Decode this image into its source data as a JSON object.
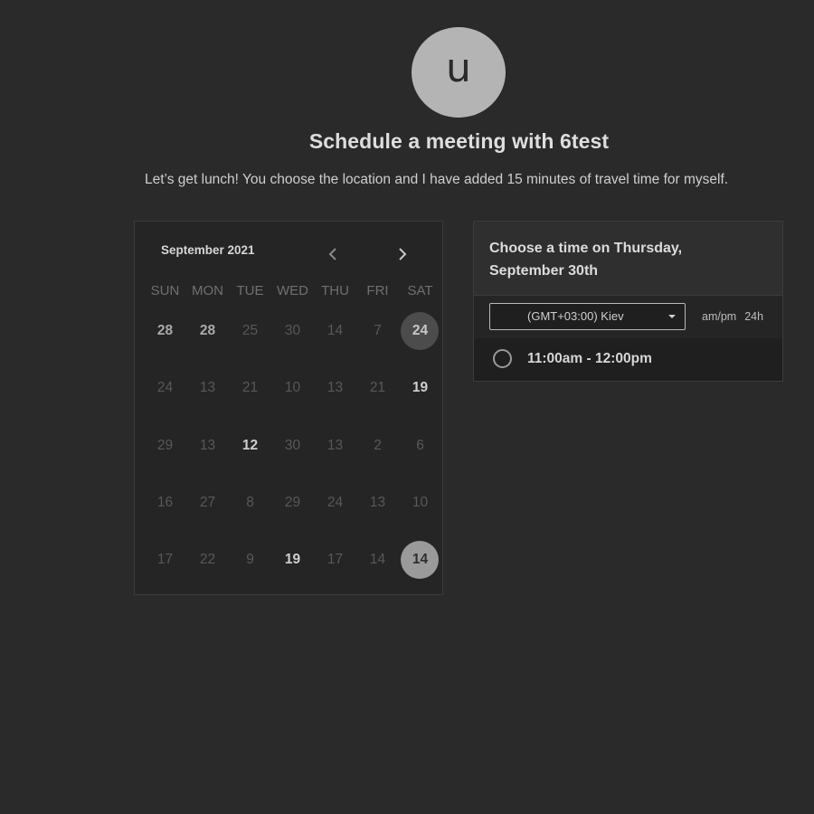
{
  "host": {
    "avatar_initial": "u",
    "title": "Schedule a meeting with 6test",
    "description": "Let’s get lunch! You choose the location and I have added 15 minutes of travel time for myself."
  },
  "calendar": {
    "month_label": "September 2021",
    "prev_icon": "chevron-left-icon",
    "next_icon": "chevron-right-icon",
    "weekdays": [
      "SUN",
      "MON",
      "TUE",
      "WED",
      "THU",
      "FRI",
      "SAT"
    ],
    "weeks": [
      [
        "28",
        "28",
        "25",
        "30",
        "14",
        "7",
        "24"
      ],
      [
        "24",
        "13",
        "21",
        "10",
        "13",
        "21",
        "19"
      ],
      [
        "29",
        "13",
        "12",
        "30",
        "13",
        "2",
        "6"
      ],
      [
        "16",
        "27",
        "8",
        "29",
        "24",
        "13",
        "10"
      ],
      [
        "17",
        "22",
        "9",
        "19",
        "17",
        "14",
        "14"
      ]
    ],
    "day_states": [
      [
        "dimmed-bold",
        "dimmed-bold",
        "",
        "",
        "",
        "",
        "highlight"
      ],
      [
        "",
        "",
        "",
        "",
        "",
        "",
        "available"
      ],
      [
        "",
        "",
        "available",
        "",
        "",
        "",
        ""
      ],
      [
        "",
        "",
        "",
        "",
        "",
        "",
        ""
      ],
      [
        "",
        "",
        "",
        "available",
        "",
        "",
        "selected"
      ]
    ]
  },
  "time_panel": {
    "header": "Choose a time on Thursday, September 30th",
    "timezone": "(GMT+03:00) Kiev",
    "format_ampm": "am/pm",
    "format_24h": "24h",
    "slots": [
      {
        "label": "11:00am - 12:00pm"
      }
    ]
  },
  "colors": {
    "background": "#2a2a2a",
    "panel": "#252525",
    "avatar": "#b4b4b4",
    "selected_day": "#9a9a9a"
  }
}
